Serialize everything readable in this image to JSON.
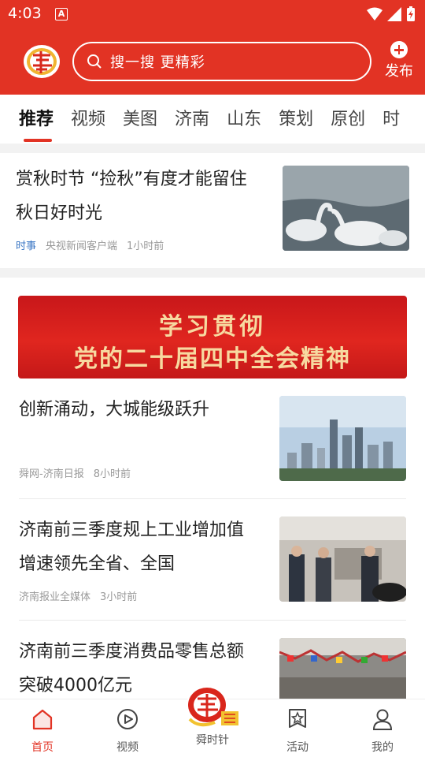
{
  "status_bar": {
    "time": "4:03",
    "badge": "A"
  },
  "header": {
    "search_placeholder": "搜一搜 更精彩",
    "publish_label": "发布"
  },
  "tabs": [
    "推荐",
    "视频",
    "美图",
    "济南",
    "山东",
    "策划",
    "原创",
    "时"
  ],
  "active_tab": "推荐",
  "articles": [
    {
      "title_l1": "赏秋时节 “捡秋”有度才能留住",
      "title_l2": "秋日好时光",
      "category": "时事",
      "source": "央视新闻客户端",
      "time": "1小时前",
      "thumb": "swans"
    },
    {
      "title_l1": "创新涌动，大城能级跃升",
      "title_l2": "",
      "category": "",
      "source": "舜网-济南日报",
      "time": "8小时前",
      "thumb": "city-skyline"
    },
    {
      "title_l1": "济南前三季度规上工业增加值",
      "title_l2": "增速领先全省、全国",
      "category": "",
      "source": "济南报业全媒体",
      "time": "3小时前",
      "thumb": "factory-visit"
    },
    {
      "title_l1": "济南前三季度消费品零售总额",
      "title_l2": "突破4000亿元",
      "category": "",
      "source": "",
      "time": "",
      "thumb": "market-flags"
    }
  ],
  "banner": {
    "line1": "学习贯彻",
    "line2": "党的二十届四中全会精神"
  },
  "bottom_nav": {
    "items": [
      {
        "label": "首页",
        "icon": "home-icon",
        "active": true
      },
      {
        "label": "视频",
        "icon": "video-icon",
        "active": false
      },
      {
        "label": "舜时针",
        "icon": "center-logo",
        "active": false
      },
      {
        "label": "活动",
        "icon": "star-badge-icon",
        "active": false
      },
      {
        "label": "我的",
        "icon": "person-icon",
        "active": false
      }
    ]
  },
  "colors": {
    "brand_red": "#e23324",
    "category_blue": "#3a76c4",
    "meta_gray": "#999999"
  }
}
